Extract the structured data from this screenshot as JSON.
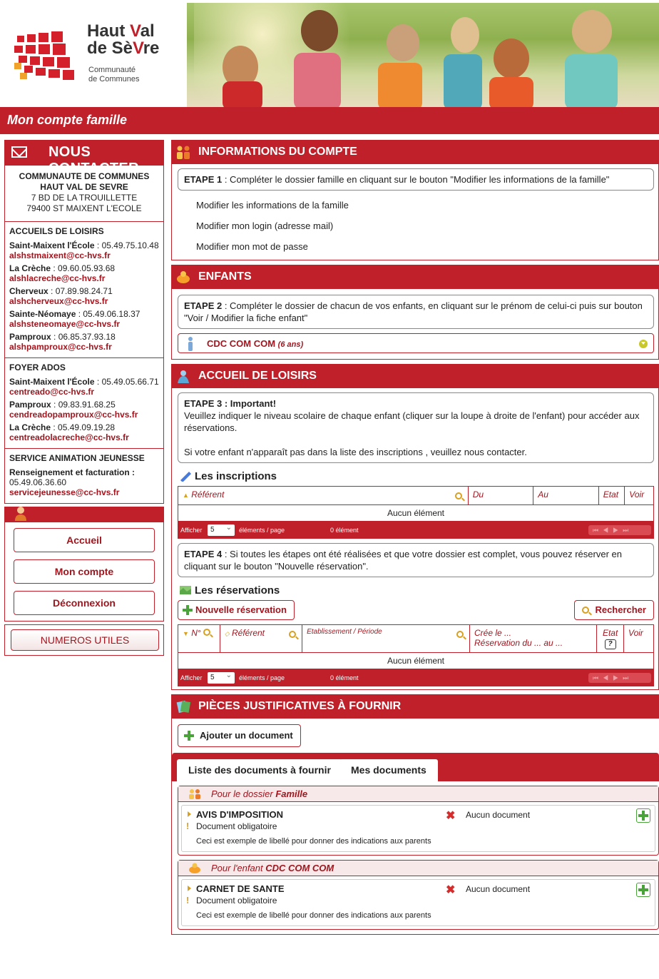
{
  "header": {
    "logo_line1": "Haut",
    "logo_v": "V",
    "logo_line1b": "al",
    "logo_line2a": "de Sè",
    "logo_line2b": "re",
    "logo_sub1": "Communauté",
    "logo_sub2": "de Communes",
    "band_title": "Mon compte famille"
  },
  "contact": {
    "title": "NOUS CONTACTER",
    "org_line1": "COMMUNAUTE DE COMMUNES",
    "org_line2": "HAUT VAL DE SEVRE",
    "addr_line1": "7 BD DE LA TROUILLETTE",
    "addr_line2": "79400 ST MAIXENT L'ECOLE",
    "sections": [
      {
        "title": "ACCUEILS DE LOISIRS",
        "entries": [
          {
            "place": "Saint-Maixent l'École",
            "phone": " : 05.49.75.10.48",
            "email": "alshstmaixent@cc-hvs.fr"
          },
          {
            "place": "La Crèche",
            "phone": " : 09.60.05.93.68",
            "email": "alshlacreche@cc-hvs.fr"
          },
          {
            "place": "Cherveux",
            "phone": " : 07.89.98.24.71",
            "email": "alshcherveux@cc-hvs.fr"
          },
          {
            "place": "Sainte-Néomaye",
            "phone": " : 05.49.06.18.37",
            "email": "alshsteneomaye@cc-hvs.fr"
          },
          {
            "place": "Pamproux",
            "phone": " : 06.85.37.93.18",
            "email": "alshpamproux@cc-hvs.fr"
          }
        ]
      },
      {
        "title": "FOYER ADOS",
        "entries": [
          {
            "place": "Saint-Maixent l'École",
            "phone": " : 05.49.05.66.71",
            "email": "centreado@cc-hvs.fr"
          },
          {
            "place": "Pamproux",
            "phone": " : 09.83.91.68.25",
            "email": "cendreadopamproux@cc-hvs.fr"
          },
          {
            "place": "La Crèche",
            "phone": " : 05.49.09.19.28",
            "email": "centreadolacreche@cc-hvs.fr"
          }
        ]
      }
    ],
    "saj_title": "SERVICE ANIMATION JEUNESSE",
    "saj_label": "Renseignement et facturation :",
    "saj_phone": "05.49.06.36.60",
    "saj_email": "servicejeunesse@cc-hvs.fr"
  },
  "nav": {
    "accueil": "Accueil",
    "mon_compte": "Mon compte",
    "deconnexion": "Déconnexion",
    "numeros": "NUMEROS UTILES"
  },
  "infos": {
    "title": "INFORMATIONS DU COMPTE",
    "etape_label": "ETAPE 1",
    "etape_text": " : Compléter le dossier famille en cliquant sur le bouton \"Modifier les informations de la famille\"",
    "links": [
      "Modifier les informations de la famille",
      "Modifier mon login (adresse mail)",
      "Modifier mon mot de passe"
    ]
  },
  "enfants": {
    "title": "ENFANTS",
    "etape_label": "ETAPE 2",
    "etape_text": " : Compléter le dossier de chacun de vos enfants, en cliquant sur le prénom de celui-ci puis sur bouton \"Voir / Modifier la fiche enfant\"",
    "child_name": "CDC COM COM",
    "child_age": "(6 ans)"
  },
  "accueil": {
    "title": "ACCUEIL DE LOISIRS",
    "etape_label": "ETAPE 3 : Important!",
    "etape_text": "Veuillez indiquer le niveau scolaire de chaque enfant (cliquer sur la loupe à droite de l'enfant) pour accéder aux réservations.",
    "etape_text2": "Si votre enfant n'apparaît pas dans la liste des inscriptions , veuillez nous contacter.",
    "inscriptions_title": "Les inscriptions",
    "insc_cols": {
      "referent": "Référent",
      "du": "Du",
      "au": "Au",
      "etat": "Etat",
      "voir": "Voir"
    },
    "empty": "Aucun élément",
    "pager": {
      "afficher": "Afficher",
      "size": "5",
      "elements": "éléments / page",
      "count": "0 élément",
      "nav": "⏮◀▶⏭"
    },
    "etape4_label": "ETAPE 4",
    "etape4_text": " : Si toutes les étapes ont été réalisées et que votre dossier est complet, vous pouvez réserver en cliquant sur le bouton \"Nouvelle réservation\".",
    "reservations_title": "Les réservations",
    "new_resa": "Nouvelle réservation",
    "search": "Rechercher",
    "resa_cols": {
      "num": "N°",
      "referent": "Référent",
      "etab": "Etablissement / Période",
      "cree": "Crée le ...",
      "resa_du": "Réservation du ... au ...",
      "etat": "Etat",
      "help": "?",
      "voir": "Voir"
    }
  },
  "pieces": {
    "title": "PIÈCES JUSTIFICATIVES À FOURNIR",
    "add_doc": "Ajouter un document",
    "tab1": "Liste des documents à fournir",
    "tab2": "Mes documents",
    "grp1_prefix": "Pour le dossier ",
    "grp1_bold": "Famille",
    "grp2_prefix": "Pour l'enfant ",
    "grp2_bold": "CDC COM COM",
    "doc1_name": "AVIS D'IMPOSITION",
    "doc2_name": "CARNET DE SANTE",
    "obligatoire": "Document obligatoire",
    "no_doc": "Aucun document",
    "libelle": "Ceci est exemple de libellé pour donner des indications aux parents"
  }
}
